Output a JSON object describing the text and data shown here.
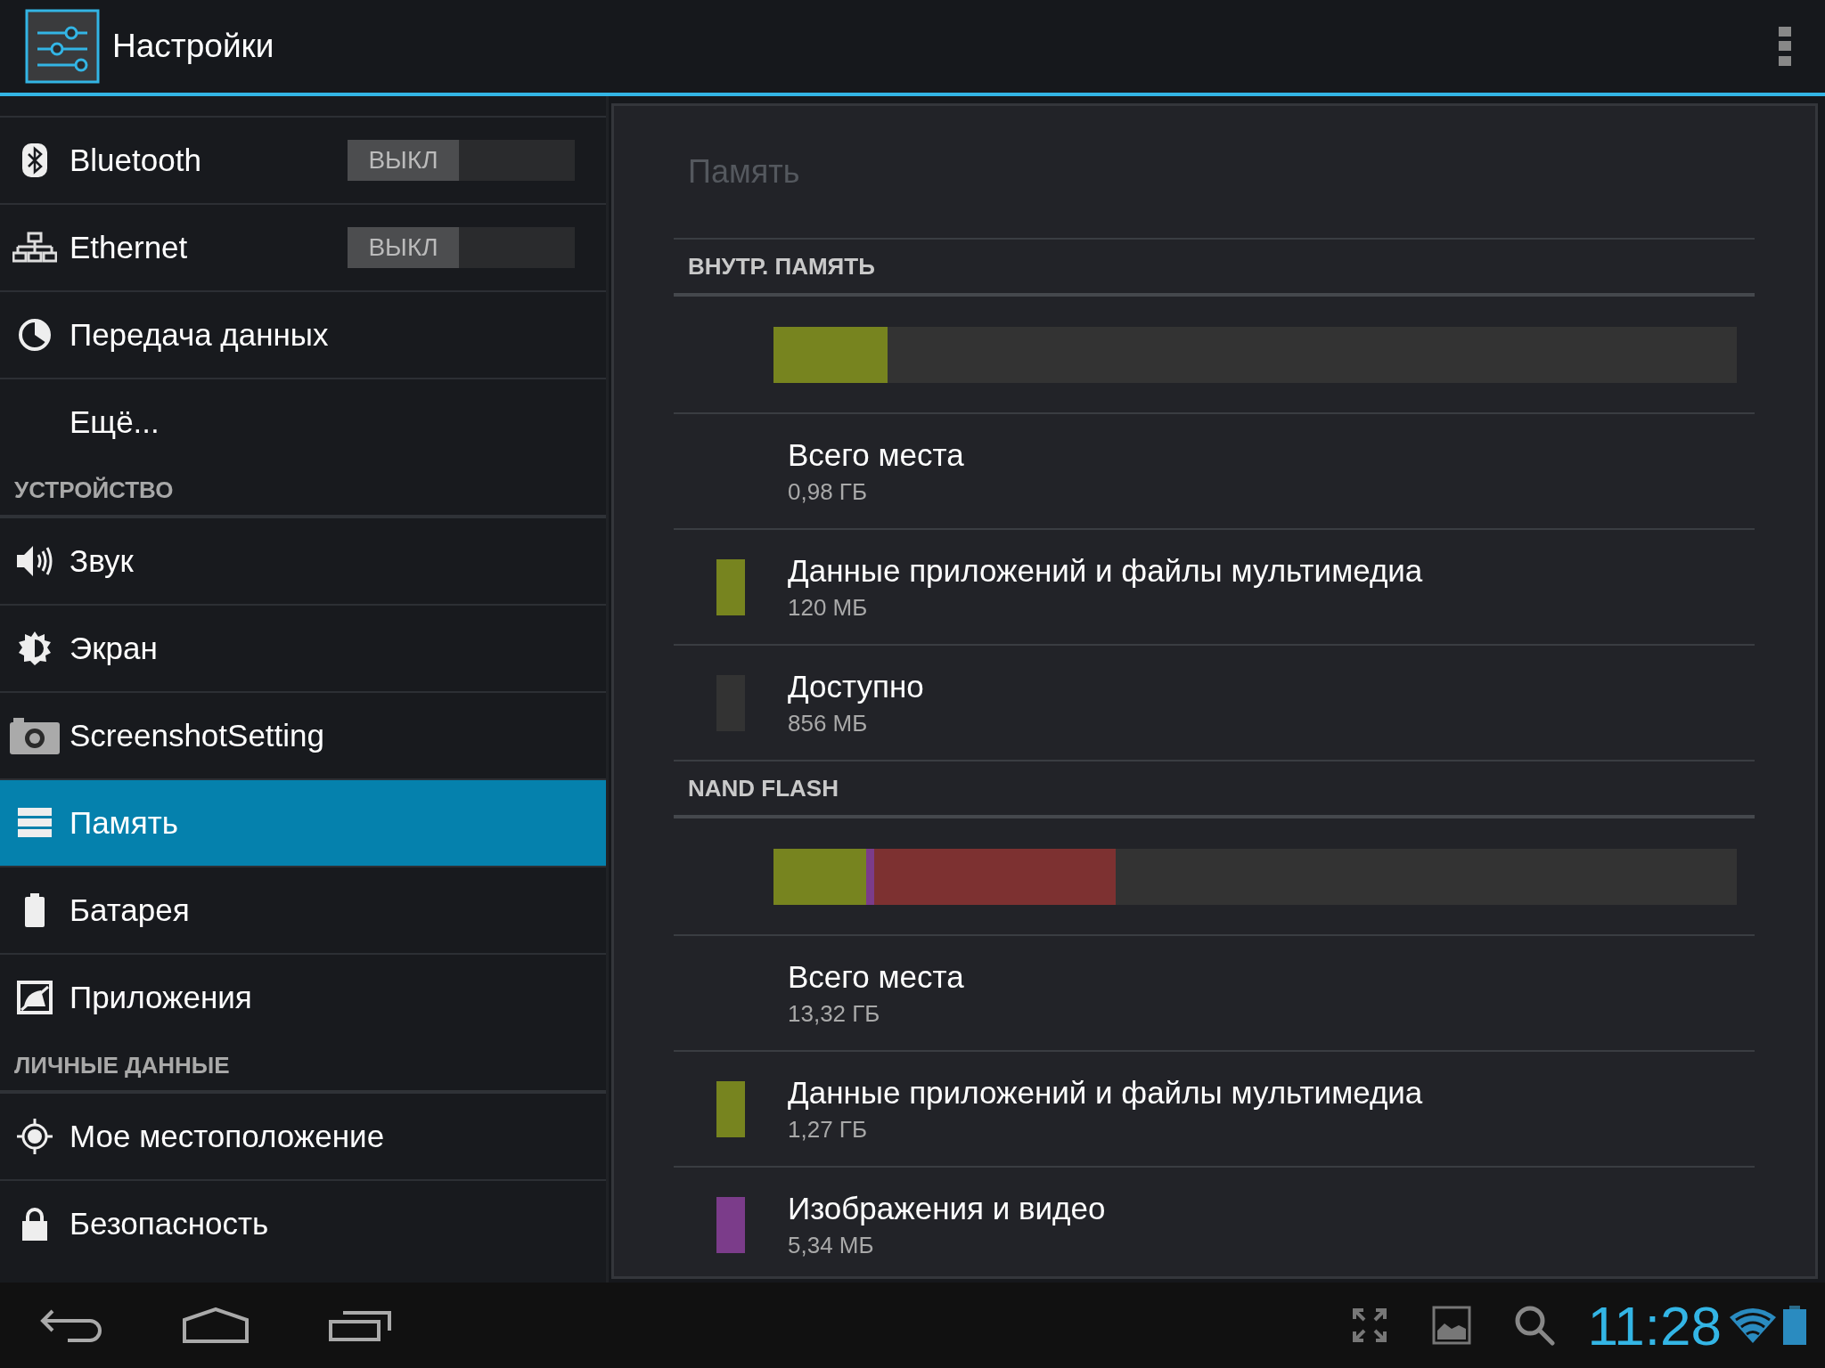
{
  "action_bar": {
    "title": "Настройки"
  },
  "sidebar": {
    "items": [
      {
        "kind": "toggle",
        "label": "Bluetooth",
        "toggle_text": "ВЫКЛ",
        "on": false,
        "selected": false
      },
      {
        "kind": "toggle",
        "label": "Ethernet",
        "toggle_text": "ВЫКЛ",
        "on": false,
        "selected": false
      },
      {
        "kind": "item",
        "label": "Передача данных",
        "selected": false
      },
      {
        "kind": "plain",
        "label": "Ещё...",
        "selected": false
      },
      {
        "kind": "header",
        "label": "УСТРОЙСТВО"
      },
      {
        "kind": "item",
        "label": "Звук",
        "selected": false
      },
      {
        "kind": "item",
        "label": "Экран",
        "selected": false
      },
      {
        "kind": "item",
        "label": "ScreenshotSetting",
        "selected": false
      },
      {
        "kind": "item",
        "label": "Память",
        "selected": true
      },
      {
        "kind": "item",
        "label": "Батарея",
        "selected": false
      },
      {
        "kind": "item",
        "label": "Приложения",
        "selected": false
      },
      {
        "kind": "header",
        "label": "ЛИЧНЫЕ ДАННЫЕ"
      },
      {
        "kind": "item",
        "label": "Мое местоположение",
        "selected": false
      },
      {
        "kind": "item",
        "label": "Безопасность",
        "selected": false
      }
    ]
  },
  "storage": {
    "title": "Память",
    "sections": [
      {
        "header": "ВНУТР. ПАМЯТЬ",
        "bar": [
          {
            "color": "#77841f",
            "level": 0.118
          }
        ],
        "entries": [
          {
            "label": "Всего места",
            "value": "0,98 ГБ"
          },
          {
            "label": "Данные приложений и файлы мультимедиа",
            "value": "120 МБ",
            "color": "#77841f"
          },
          {
            "label": "Доступно",
            "value": "856 МБ",
            "color": "#333333"
          }
        ]
      },
      {
        "header": "NAND FLASH",
        "bar": [
          {
            "color": "#77841f",
            "level": 0.096
          },
          {
            "color": "#7b3c8a",
            "level": 0.009
          },
          {
            "color": "#7d3131",
            "level": 0.25
          }
        ],
        "entries": [
          {
            "label": "Всего места",
            "value": "13,32 ГБ"
          },
          {
            "label": "Данные приложений и файлы мультимедиа",
            "value": "1,27 ГБ",
            "color": "#77841f"
          },
          {
            "label": "Изображения и видео",
            "value": "5,34 МБ",
            "color": "#7b3c8a"
          }
        ]
      }
    ]
  },
  "status_bar": {
    "time": "11:28"
  }
}
